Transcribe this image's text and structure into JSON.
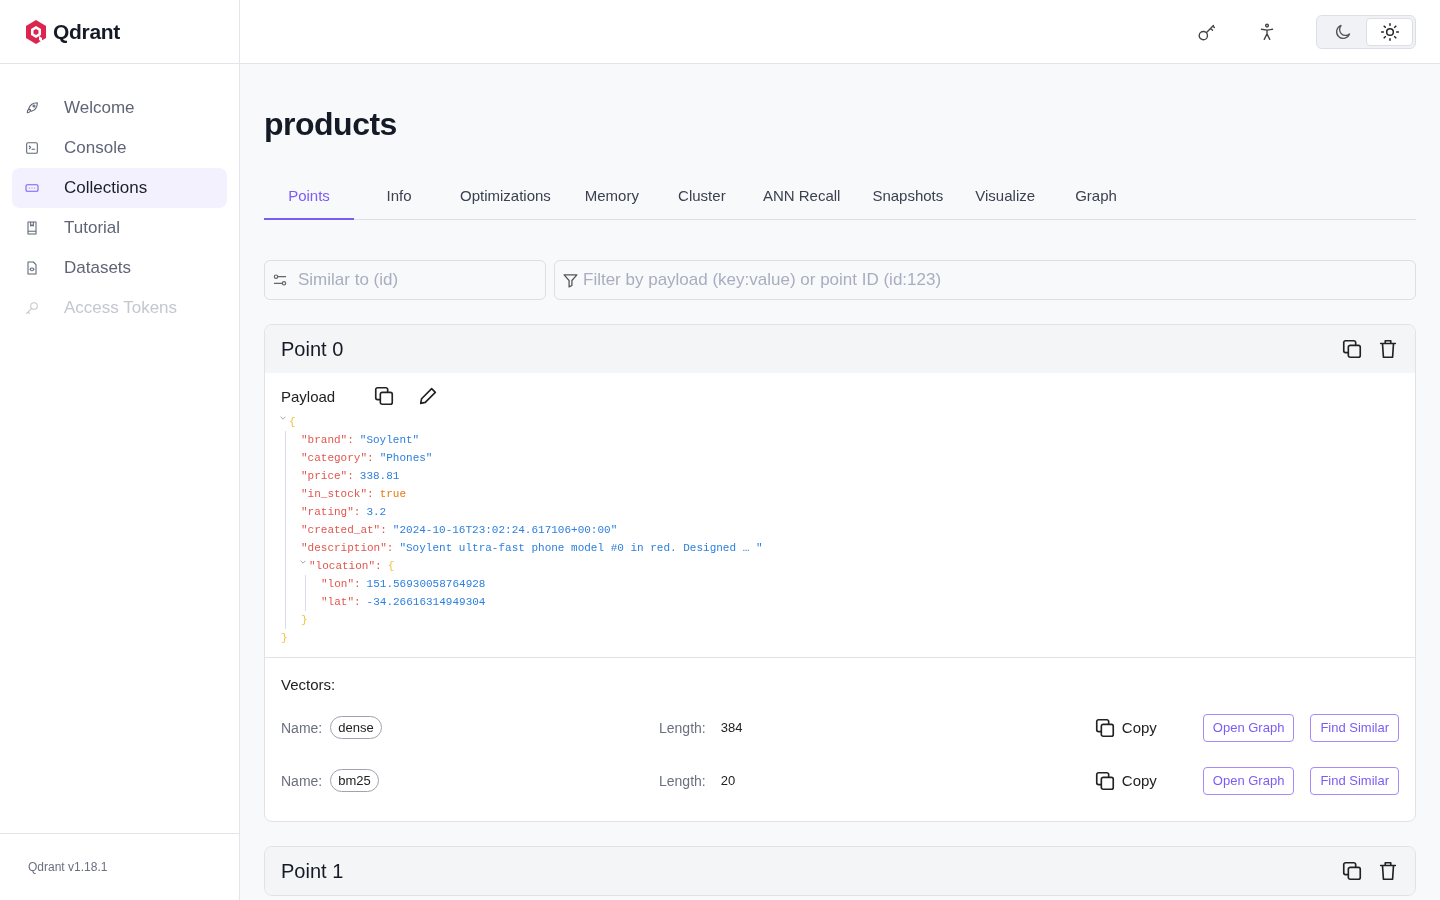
{
  "brand": {
    "name": "Qdrant"
  },
  "sidebar": {
    "items": [
      {
        "label": "Welcome",
        "selected": false,
        "disabled": false
      },
      {
        "label": "Console",
        "selected": false,
        "disabled": false
      },
      {
        "label": "Collections",
        "selected": true,
        "disabled": false
      },
      {
        "label": "Tutorial",
        "selected": false,
        "disabled": false
      },
      {
        "label": "Datasets",
        "selected": false,
        "disabled": false
      },
      {
        "label": "Access Tokens",
        "selected": false,
        "disabled": true
      }
    ],
    "version": "Qdrant v1.18.1"
  },
  "header": {
    "theme_toggle": [
      {
        "selected": false
      },
      {
        "selected": true
      }
    ]
  },
  "page": {
    "title": "products"
  },
  "tabs": [
    {
      "label": "Points",
      "selected": true
    },
    {
      "label": "Info",
      "selected": false
    },
    {
      "label": "Optimizations",
      "selected": false
    },
    {
      "label": "Memory",
      "selected": false
    },
    {
      "label": "Cluster",
      "selected": false
    },
    {
      "label": "ANN Recall",
      "selected": false
    },
    {
      "label": "Snapshots",
      "selected": false
    },
    {
      "label": "Visualize",
      "selected": false
    },
    {
      "label": "Graph",
      "selected": false
    }
  ],
  "search": {
    "similar": {
      "placeholder": "Similar to (id)"
    },
    "filter": {
      "placeholder": "Filter by payload (key:value) or point ID (id:123)"
    }
  },
  "points": [
    {
      "title": "Point 0",
      "payload_label": "Payload",
      "payload": {
        "open": "{",
        "close": "}",
        "expanded": true,
        "entries": [
          {
            "key": "\"brand\":",
            "value": "\"Soylent\"",
            "kind": "string"
          },
          {
            "key": "\"category\":",
            "value": "\"Phones\"",
            "kind": "string"
          },
          {
            "key": "\"price\":",
            "value": "338.81",
            "kind": "number"
          },
          {
            "key": "\"in_stock\":",
            "value": "true",
            "kind": "boolean"
          },
          {
            "key": "\"rating\":",
            "value": "3.2",
            "kind": "number"
          },
          {
            "key": "\"created_at\":",
            "value": "\"2024-10-16T23:02:24.617106+00:00\"",
            "kind": "string"
          },
          {
            "key": "\"description\":",
            "value": "\"Soylent ultra-fast phone model #0 in red. Designed … \"",
            "kind": "string"
          },
          {
            "key": "\"location\":",
            "kind": "object",
            "open": "{",
            "close": "}",
            "expanded": true,
            "entries": [
              {
                "key": "\"lon\":",
                "value": "151.56930058764928",
                "kind": "number"
              },
              {
                "key": "\"lat\":",
                "value": "-34.26616314949304",
                "kind": "number"
              }
            ]
          }
        ]
      },
      "vectors_label": "Vectors:",
      "vectors": [
        {
          "name_label": "Name:",
          "name": "dense",
          "length_label": "Length:",
          "length": "384",
          "copy": "Copy",
          "open_graph": "Open Graph",
          "find_similar": "Find Similar"
        },
        {
          "name_label": "Name:",
          "name": "bm25",
          "length_label": "Length:",
          "length": "20",
          "copy": "Copy",
          "open_graph": "Open Graph",
          "find_similar": "Find Similar"
        }
      ]
    },
    {
      "title": "Point 1"
    }
  ]
}
